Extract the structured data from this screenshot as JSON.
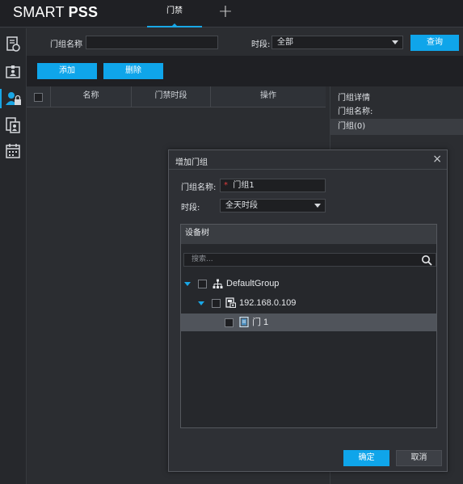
{
  "app": {
    "logo_prefix": "SMART",
    "logo_suffix": "PSS"
  },
  "tabs": {
    "active": "门禁",
    "add_symbol": "+"
  },
  "nav": {
    "items": [
      {
        "name": "device-manage-icon"
      },
      {
        "name": "access-card-icon"
      },
      {
        "name": "door-group-icon",
        "active": true
      },
      {
        "name": "record-query-icon"
      },
      {
        "name": "schedule-icon"
      }
    ]
  },
  "filter": {
    "group_name_label": "门组名称",
    "group_name_value": "",
    "period_label": "时段:",
    "period_value": "全部",
    "query_button": "查询"
  },
  "actions": {
    "add_button": "添加",
    "delete_button": "删除"
  },
  "table": {
    "columns": [
      "名称",
      "门禁时段",
      "操作"
    ]
  },
  "detail": {
    "title": "门组详情",
    "name_label": "门组名称:",
    "group_item": "门组(0)"
  },
  "dialog": {
    "title": "增加门组",
    "close_symbol": "×",
    "name_label": "门组名称:",
    "required_mark": "*",
    "name_value": "门组1",
    "period_label": "时段:",
    "period_value": "全天时段",
    "tree_title": "设备树",
    "search_placeholder": "搜索...",
    "tree": {
      "root": "DefaultGroup",
      "device": "192.168.0.109",
      "door": "门 1"
    },
    "ok_button": "确定",
    "cancel_button": "取消"
  },
  "colors": {
    "accent": "#19a7e6",
    "button_blue": "#0fa5ea",
    "required": "#e03c3c"
  }
}
